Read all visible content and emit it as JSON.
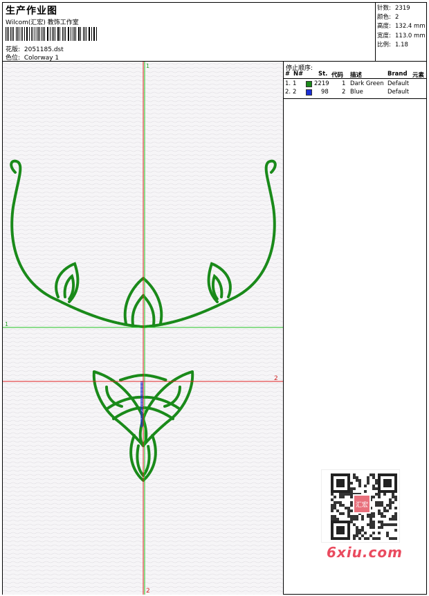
{
  "header": {
    "title": "生产作业图",
    "company": "Wilcom(汇宏) 教饰工作室",
    "design_label": "花版:",
    "design_value": "2051185.dst",
    "colorway_label": "色位:",
    "colorway_value": "Colorway 1"
  },
  "stats": {
    "stitches_label": "针数:",
    "stitches_value": "2319",
    "colors_label": "颜色:",
    "colors_value": "2",
    "height_label": "高度:",
    "height_value": "132.4 mm",
    "width_label": "宽度:",
    "width_value": "113.0 mm",
    "ratio_label": "比例:",
    "ratio_value": "1.18"
  },
  "stop_sequence": {
    "title": "停止顺序:",
    "columns": [
      "#",
      "N#",
      "St.",
      "代码",
      "描述",
      "Brand",
      "元素"
    ],
    "rows": [
      {
        "num": "1.",
        "n": "1",
        "stitches": "2219",
        "code": "1",
        "desc": "Dark Green",
        "brand": "Default",
        "color": "#1a8a1a"
      },
      {
        "num": "2.",
        "n": "2",
        "stitches": "98",
        "code": "2",
        "desc": "Blue",
        "brand": "Default",
        "color": "#1a2fd6"
      }
    ]
  },
  "canvas": {
    "guide_labels": {
      "v1": "1",
      "h1": "1",
      "h2": "2",
      "v2": "2"
    },
    "colors": {
      "green_guide": "#22c422",
      "red_guide": "#e02020",
      "stitch_green": "#1a8a1a",
      "stitch_blue": "#1a2fd6"
    }
  },
  "watermark": {
    "site": "6xiu.com",
    "qr_center": "汇宏"
  }
}
